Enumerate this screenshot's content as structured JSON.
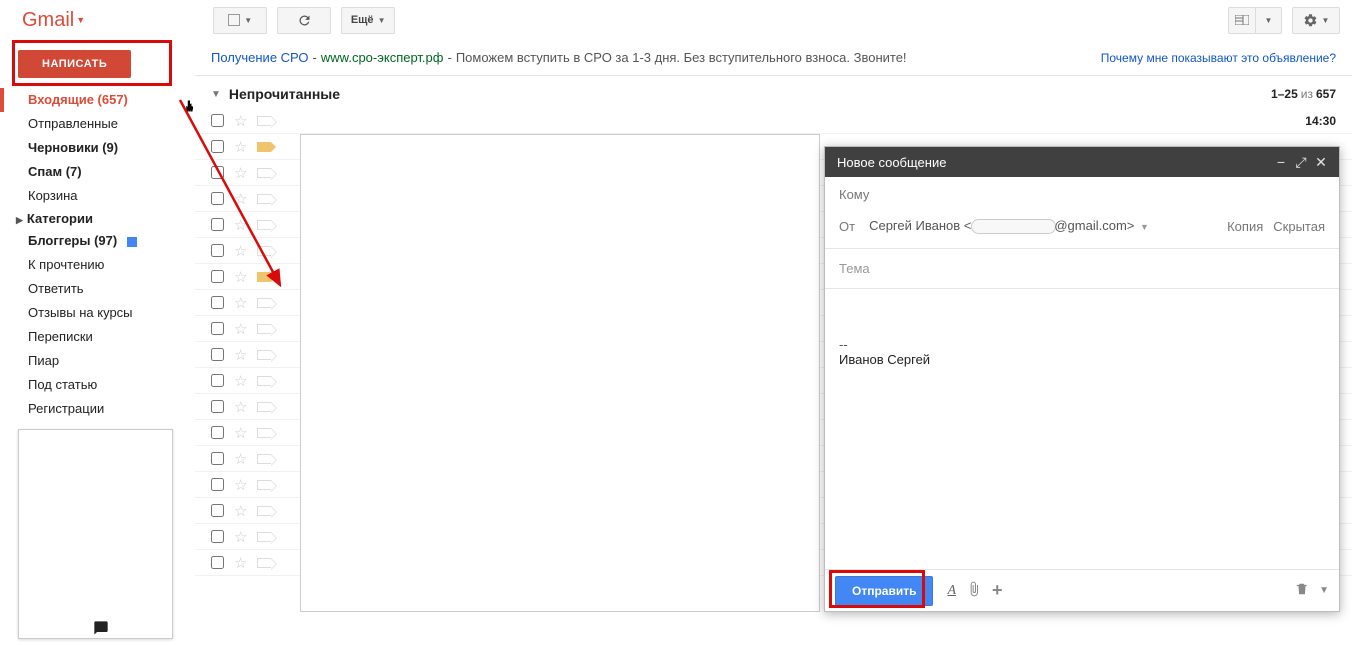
{
  "brand": {
    "name": "Gmail"
  },
  "toolbar": {
    "more_label": "Ещё"
  },
  "sidebar": {
    "compose_label": "НАПИСАТЬ",
    "items": [
      {
        "label": "Входящие (657)",
        "cls": "active"
      },
      {
        "label": "Отправленные"
      },
      {
        "label": "Черновики (9)",
        "cls": "bold"
      },
      {
        "label": "Спам (7)",
        "cls": "bold"
      },
      {
        "label": "Корзина"
      }
    ],
    "categories_label": "Категории",
    "labels": [
      {
        "label": "Блоггеры (97)",
        "cls": "bold",
        "color": true
      },
      {
        "label": "К прочтению"
      },
      {
        "label": "Ответить"
      },
      {
        "label": "Отзывы на курсы"
      },
      {
        "label": "Переписки"
      },
      {
        "label": "Пиар"
      },
      {
        "label": "Под статью"
      },
      {
        "label": "Регистрации"
      }
    ]
  },
  "ad": {
    "title": "Получение СРО",
    "url": "www.сро-эксперт.рф",
    "text": "Поможем вступить в СРО за 1-3 дня. Без вступительного взноса. Звоните!",
    "why": "Почему мне показывают это объявление?"
  },
  "section": {
    "name": "Непрочитанные"
  },
  "pager": {
    "range": "1–25",
    "of": "из",
    "total": "657"
  },
  "first_row": {
    "time": "14:30"
  },
  "compose": {
    "title": "Новое сообщение",
    "to_label": "Кому",
    "from_label": "От",
    "from_name": "Сергей Иванов <",
    "from_domain": "@gmail.com>",
    "cc_label": "Копия",
    "bcc_label": "Скрытая",
    "subject_placeholder": "Тема",
    "sig_sep": "--",
    "signature": "Иванов Сергей",
    "send_label": "Отправить",
    "fmt": "A"
  }
}
